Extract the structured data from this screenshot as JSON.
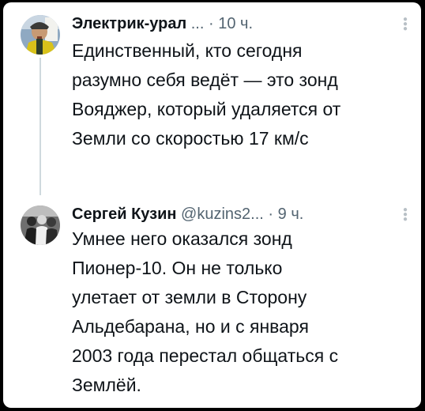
{
  "tweets": [
    {
      "author": "Электрик-урал",
      "handle": "",
      "ellipsis": "...",
      "separator": "·",
      "time": "10 ч.",
      "text": "Единственный, кто сегодня\nразумно себя ведёт — это зонд\nВояджер, который удаляется от\nЗемли со скоростью 17 км/с",
      "avatar_icon": "avatar-man-cap-photo"
    },
    {
      "author": "Сергей Кузин",
      "handle": "@kuzins2",
      "ellipsis": "...",
      "separator": "·",
      "time": "9 ч.",
      "text": "Умнее него оказался зонд\nПионер-10. Он не только\nулетает от земли в Сторону\nАльдебарана,  но и с января\n2003 года перестал общаться с\nЗемлёй.",
      "avatar_icon": "avatar-group-photo"
    }
  ],
  "colors": {
    "background": "#ffffff",
    "text": "#0f1419",
    "secondary": "#536471",
    "thread_line": "#cfd9de",
    "frame": "#000000"
  }
}
